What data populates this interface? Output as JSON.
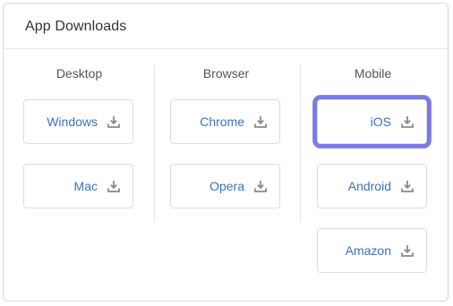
{
  "panel": {
    "title": "App Downloads"
  },
  "columns": [
    {
      "heading": "Desktop",
      "buttons": [
        {
          "label": "Windows",
          "icon": "download-icon"
        },
        {
          "label": "Mac",
          "icon": "download-icon"
        }
      ]
    },
    {
      "heading": "Browser",
      "buttons": [
        {
          "label": "Chrome",
          "icon": "download-icon"
        },
        {
          "label": "Opera",
          "icon": "download-icon"
        }
      ]
    },
    {
      "heading": "Mobile",
      "buttons": [
        {
          "label": "iOS",
          "icon": "download-icon",
          "focused": true
        },
        {
          "label": "Android",
          "icon": "download-icon"
        },
        {
          "label": "Amazon",
          "icon": "download-icon"
        }
      ]
    }
  ],
  "colors": {
    "link": "#3a73b8",
    "focus_ring": "#7b78e8",
    "icon": "#8a8a8a"
  }
}
